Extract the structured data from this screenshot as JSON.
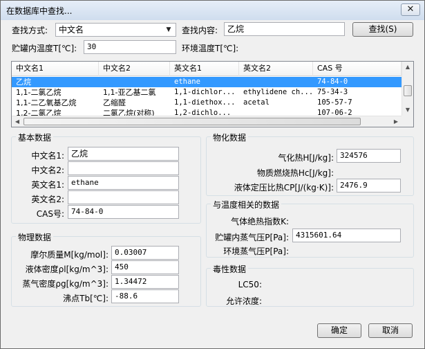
{
  "window": {
    "title": "在数据库中查找...",
    "close_glyph": "✕"
  },
  "search": {
    "method_label": "查找方式:",
    "method_value": "中文名",
    "content_label": "查找内容:",
    "content_value": "乙烷",
    "search_button": "查找(S)",
    "tank_temp_label": "贮罐内温度T[℃]:",
    "tank_temp_value": "30",
    "env_temp_label": "环境温度T[℃]:"
  },
  "list": {
    "columns": [
      "中文名1",
      "中文名2",
      "英文名1",
      "英文名2",
      "CAS 号"
    ],
    "rows": [
      {
        "cn1": "乙烷",
        "cn2": "",
        "en1": "ethane",
        "en2": "",
        "cas": "74-84-0",
        "selected": true
      },
      {
        "cn1": "1,1-二氯乙烷",
        "cn2": "1,1-亚乙基二氯",
        "en1": "1,1-dichlor...",
        "en2": "ethylidene ch...",
        "cas": "75-34-3",
        "selected": false
      },
      {
        "cn1": "1,1-二乙氧基乙烷",
        "cn2": "乙缩醛",
        "en1": "1,1-diethox...",
        "en2": "acetal",
        "cas": "105-57-7",
        "selected": false
      },
      {
        "cn1": "1,2-二氯乙烷",
        "cn2": "二氯乙烷(对称)",
        "en1": "1,2-dichlo...",
        "en2": "",
        "cas": "107-06-2",
        "selected": false
      }
    ]
  },
  "basic": {
    "title": "基本数据",
    "cn1_label": "中文名1:",
    "cn1_value": "乙烷",
    "cn2_label": "中文名2:",
    "cn2_value": "",
    "en1_label": "英文名1:",
    "en1_value": "ethane",
    "en2_label": "英文名2:",
    "en2_value": "",
    "cas_label": "CAS号:",
    "cas_value": "74-84-0"
  },
  "physical": {
    "title": "物理数据",
    "molar_label": "摩尔质量M[kg/mol]:",
    "molar_value": "0.03007",
    "liq_density_label": "液体密度ρl[kg/m^3]:",
    "liq_density_value": "450",
    "vap_density_label": "蒸气密度ρg[kg/m^3]:",
    "vap_density_value": "1.34472",
    "boiling_label": "沸点Tb[℃]:",
    "boiling_value": "-88.6"
  },
  "chemical": {
    "title": "物化数据",
    "vap_heat_label": "气化热H[J/kg]:",
    "vap_heat_value": "324576",
    "comb_heat_label": "物质燃烧热Hc[J/kg]:",
    "cp_label": "液体定压比热CP[J/(kg·K)]:",
    "cp_value": "2476.9"
  },
  "temperature": {
    "title": "与温度相关的数据",
    "adiabatic_label": "气体绝热指数K:",
    "tank_vp_label": "贮罐内蒸气压P[Pa]:",
    "tank_vp_value": "4315601.64",
    "env_vp_label": "环境蒸气压P[Pa]:"
  },
  "toxicity": {
    "title": "毒性数据",
    "lc50_label": "LC50:",
    "allow_label": "允许浓度:"
  },
  "footer": {
    "ok": "确定",
    "cancel": "取消"
  }
}
